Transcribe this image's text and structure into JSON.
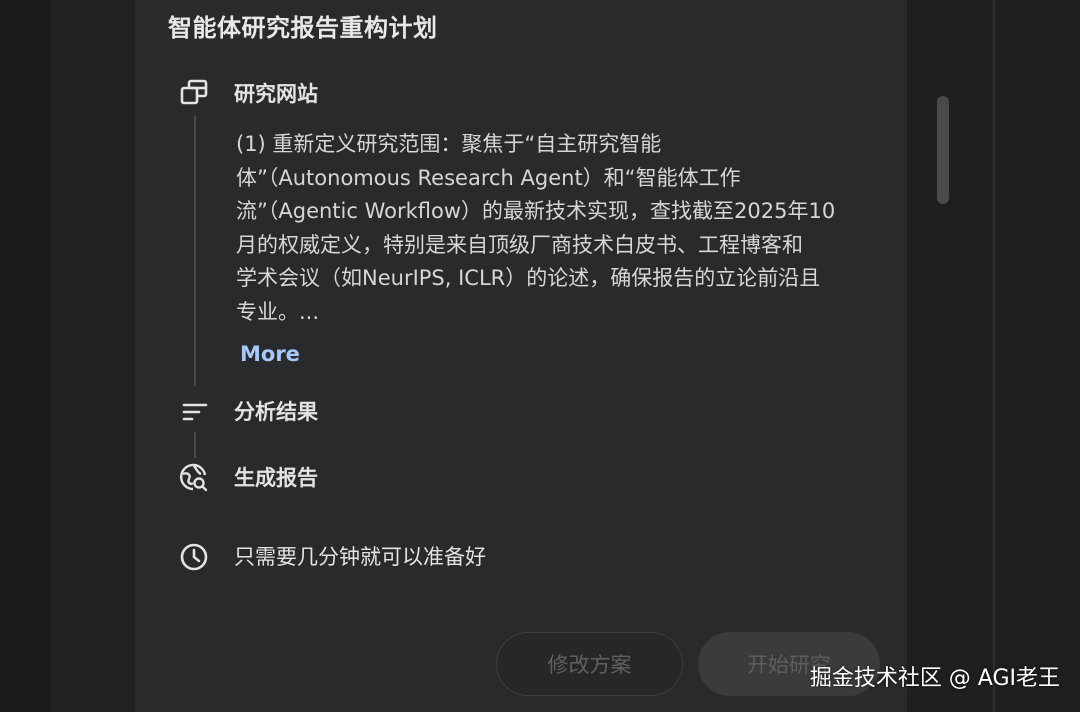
{
  "plan": {
    "title": "智能体研究报告重构计划",
    "steps": [
      {
        "label": "研究网站",
        "icon": "browse-window-icon"
      },
      {
        "label": "分析结果",
        "icon": "sort-lines-icon"
      },
      {
        "label": "生成报告",
        "icon": "globe-search-icon"
      }
    ],
    "description_lines": [
      "(1) 重新定义研究范围：聚焦于“自主研究智能",
      "体”（Autonomous Research Agent）和“智能体工作",
      "流”（Agentic Workflow）的最新技术实现，查找截至2025年10",
      "月的权威定义，特别是来自顶级厂商技术白皮书、工程博客和",
      "学术会议（如NeurIPS, ICLR）的论述，确保报告的立论前沿且",
      "专业。..."
    ],
    "more_label": "More",
    "time_estimate": "只需要几分钟就可以准备好",
    "time_icon": "clock-icon"
  },
  "actions": {
    "modify_label": "修改方案",
    "start_label": "开始研究"
  },
  "watermark": "掘金技术社区 @ AGI老王"
}
